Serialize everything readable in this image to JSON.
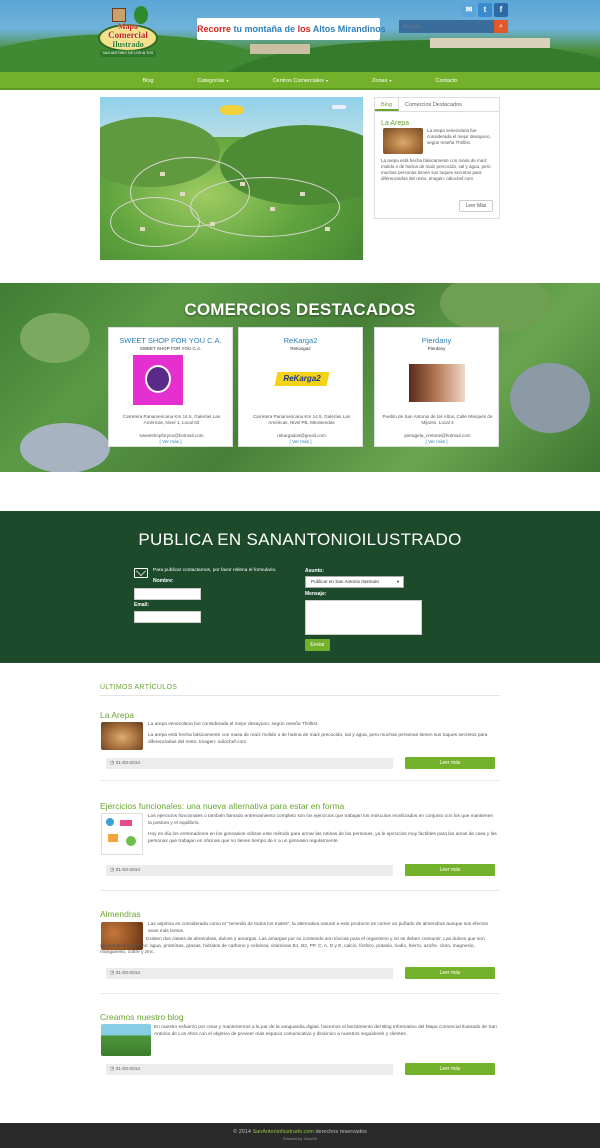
{
  "header": {
    "logo_line1": "Mapa",
    "logo_line2": "Comercial",
    "logo_line3": "Ilustrado",
    "logo_ribbon": "SAN ANTONIO DE LOS ALTOS",
    "tagline_part1": "Recorre",
    "tagline_part2": "tu montaña de",
    "tagline_part3": "los",
    "tagline_part4": "Altos Mirandinos",
    "search_placeholder": "Buscar...",
    "social": [
      {
        "icon": "mail-icon",
        "glyph": "✉",
        "color": "#5ba4d9"
      },
      {
        "icon": "twitter-icon",
        "glyph": "t",
        "color": "#3a8ad1"
      },
      {
        "icon": "facebook-icon",
        "glyph": "f",
        "color": "#2f6aa8"
      }
    ]
  },
  "nav": {
    "items": [
      {
        "label": "Blog",
        "dropdown": false
      },
      {
        "label": "Categorías",
        "dropdown": true
      },
      {
        "label": "Centros Comerciales",
        "dropdown": true
      },
      {
        "label": "Zonas",
        "dropdown": true
      },
      {
        "label": "Contacto",
        "dropdown": false
      }
    ]
  },
  "widget": {
    "tabs": [
      "Blog",
      "Comercios Destacados"
    ],
    "title": "La Arepa",
    "text1": "La arepa venezolana fue considerada el mejor desayuno, según reseña Thrillist.",
    "text2": "La arepa está hecha básicamente con masa de maíz molido o de harina de maíz precocido, sal y agua, pero muchas personas tienen sus toques secretos para diferenciarlas del resto. Imagen: odiochef.com",
    "button": "Leer Más"
  },
  "featured": {
    "title": "COMERCIOS DESTACADOS",
    "cards": [
      {
        "name": "SWEET SHOP FOR YOU C.A.",
        "subtitle": "SWEET SHOP FOR YOU C.A.",
        "address1": "Carretera Panamericana Km 14.5, Galerías Las Américas, Nivel 1, Local 63",
        "address2": "sweetshopforyou@hotmail.com",
        "more": "[ Ver más ]"
      },
      {
        "name": "ReKarga2",
        "subtitle": "ReKarga2",
        "logo_text": "ReKarga2",
        "address1": "Carretera Panamericana Km 14.5, Galerías Las Américas, Nivel PB, Mininiendas",
        "address2": "rekargados@gmail.com",
        "more": "[ Ver más ]"
      },
      {
        "name": "Pierdany",
        "subtitle": "Pierdany",
        "address1": "Pueblo de San Antonio de los Altos, Calle Marqués de Mijares, Local 3",
        "address2": "pieragela_cretone@hotmail.com",
        "more": "[ Ver más ]"
      }
    ]
  },
  "publica": {
    "title": "PUBLICA EN SANANTONIOILUSTRADO",
    "intro": "Para publicar contactarnos, por favor rellena el formulario.",
    "nombre_label": "Nombre:",
    "email_label": "Email:",
    "asunto_label": "Asunto:",
    "asunto_value": "Publicar en San Antonio Ilustrado",
    "mensaje_label": "Mensaje:",
    "send_button": "Enviar"
  },
  "articles": {
    "section_title": "ÚLTIMOS ARTÍCULOS",
    "items": [
      {
        "title": "La Arepa",
        "p1": "La arepa venezolana fue considerada el mejor desayuno, según reseña Thrillist.",
        "p2": "La arepa está hecha básicamente con masa de maíz molido o de harina de maíz precocido, sal y agua, pero muchas personas tienen sus toques secretos para diferenciarlas del resto. Imagen: odiochef.com",
        "date": "31-03-2014",
        "button": "Leer más"
      },
      {
        "title": "Ejercicios funcionales: una nueva alternativa para estar en forma",
        "p1": "Los ejercicios funcionales o también llamado entrenamiento completo son los ejercicios que trabajan los músculos movilizados en conjunto con los que mantienen la postura y el equilibrio.",
        "p2": "Hoy en día los entrenadores en los gimnasios utilizan este método para armar las rutinas de las personas, ya le ejercicios muy factibles para las amas de casa y las personas que trabajan en oficinas que no tienen tiempo de ir a un gimnasio regularmente.",
        "date": "31-03-2014",
        "button": "Leer más"
      },
      {
        "title": "Almendras",
        "p1": "Las aspirina es considerada como el \"remedio de todos los males\", la alternativa natural a este producto es comer un puñado de almendras aunque sus efectos sean más lentos.",
        "p2": "Existen dos clases de almendras, dulces y amargas. Las amargas por su contenido son tóxicas para el organismo y no se deben consumir. Las dulces que son comestibles contienen: agua, proteínas, grasas, hidratos de carbono y celulosa, vitaminas B1, B2, PP, C, A, D y E, calcio, fósforo, potasio, sodio, hierro, azufre, cloro, magnesio, manganeso, cobre y zinc.",
        "date": "31-03-2014",
        "button": "Leer más"
      },
      {
        "title": "Creamos nuestro blog",
        "p1": "En nuestro esfuerzo por crear y mantenernos a la par de la vanguardia digital, hacemos el lanzamiento del Blog Informativo del Mapa Comercial Ilustrado de San Antonio de Los Altos con el objetivo de proveer más espacio comunicativo y dinámico a nuestros seguidores y clientes.",
        "p2": "",
        "date": "31-03-2014",
        "button": "Leer más"
      }
    ]
  },
  "footer": {
    "copyright_prefix": "© 2014",
    "site_link": "SanAntonioIlustrado.com",
    "copyright_suffix": "derechos reservados",
    "powered": "Powered by: ZeusOb"
  },
  "colors": {
    "accent_green": "#74b12b",
    "title_green": "#6aa531",
    "dark_green": "#1c4a2b",
    "link_blue": "#2e7fb8",
    "tagline_red": "#d8241c"
  }
}
